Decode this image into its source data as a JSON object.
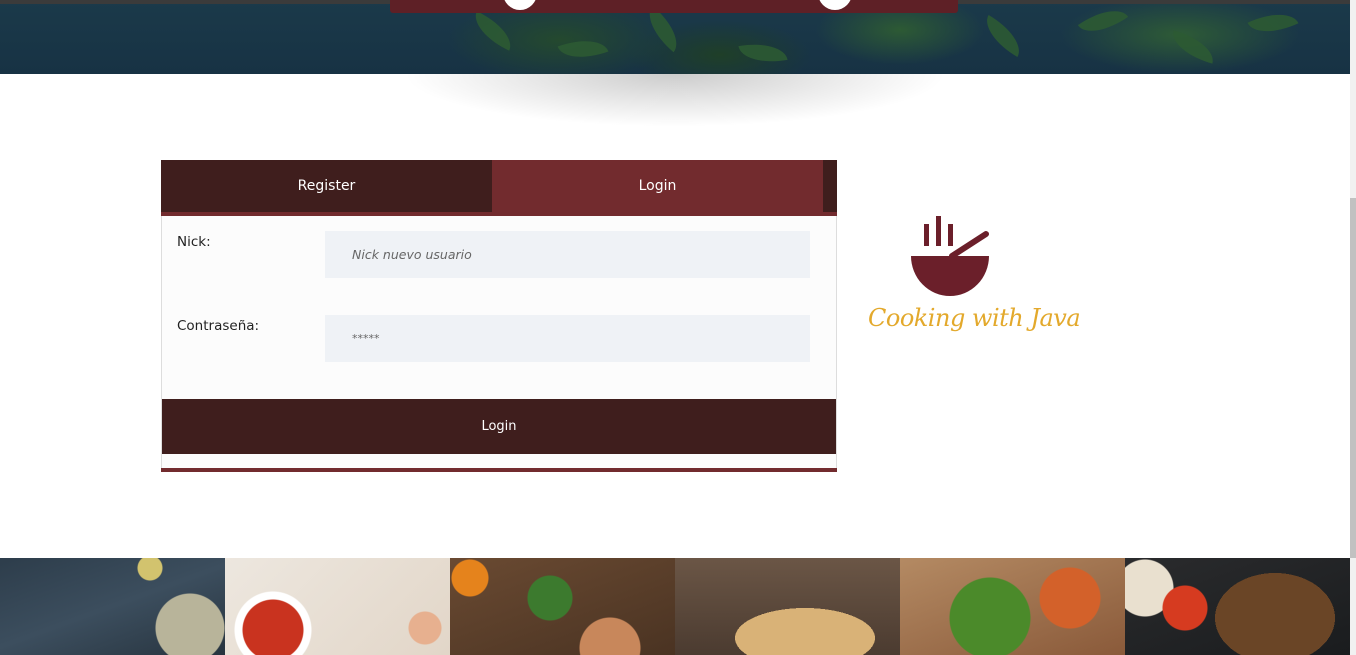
{
  "tabs": {
    "register_label": "Register",
    "login_label": "Login",
    "active": "Login"
  },
  "form": {
    "nick_label": "Nick:",
    "nick_placeholder": "Nick nuevo usuario",
    "password_label": "Contraseña:",
    "password_placeholder": "*****",
    "submit_label": "Login"
  },
  "logo": {
    "text": "Cooking with Java",
    "icon": "bowl-icon",
    "color": "#6b1f2a",
    "text_color": "#e3a92c"
  },
  "colors": {
    "dark_brown": "#3f1e1d",
    "accent_red": "#722b2e",
    "input_bg": "#eff2f6"
  },
  "photos": [
    {
      "icon": "food-photo-mussels"
    },
    {
      "icon": "food-photo-tomato-soup"
    },
    {
      "icon": "food-photo-oranges"
    },
    {
      "icon": "food-photo-flatbread"
    },
    {
      "icon": "food-photo-pizza"
    },
    {
      "icon": "food-photo-grilled-fish"
    }
  ]
}
